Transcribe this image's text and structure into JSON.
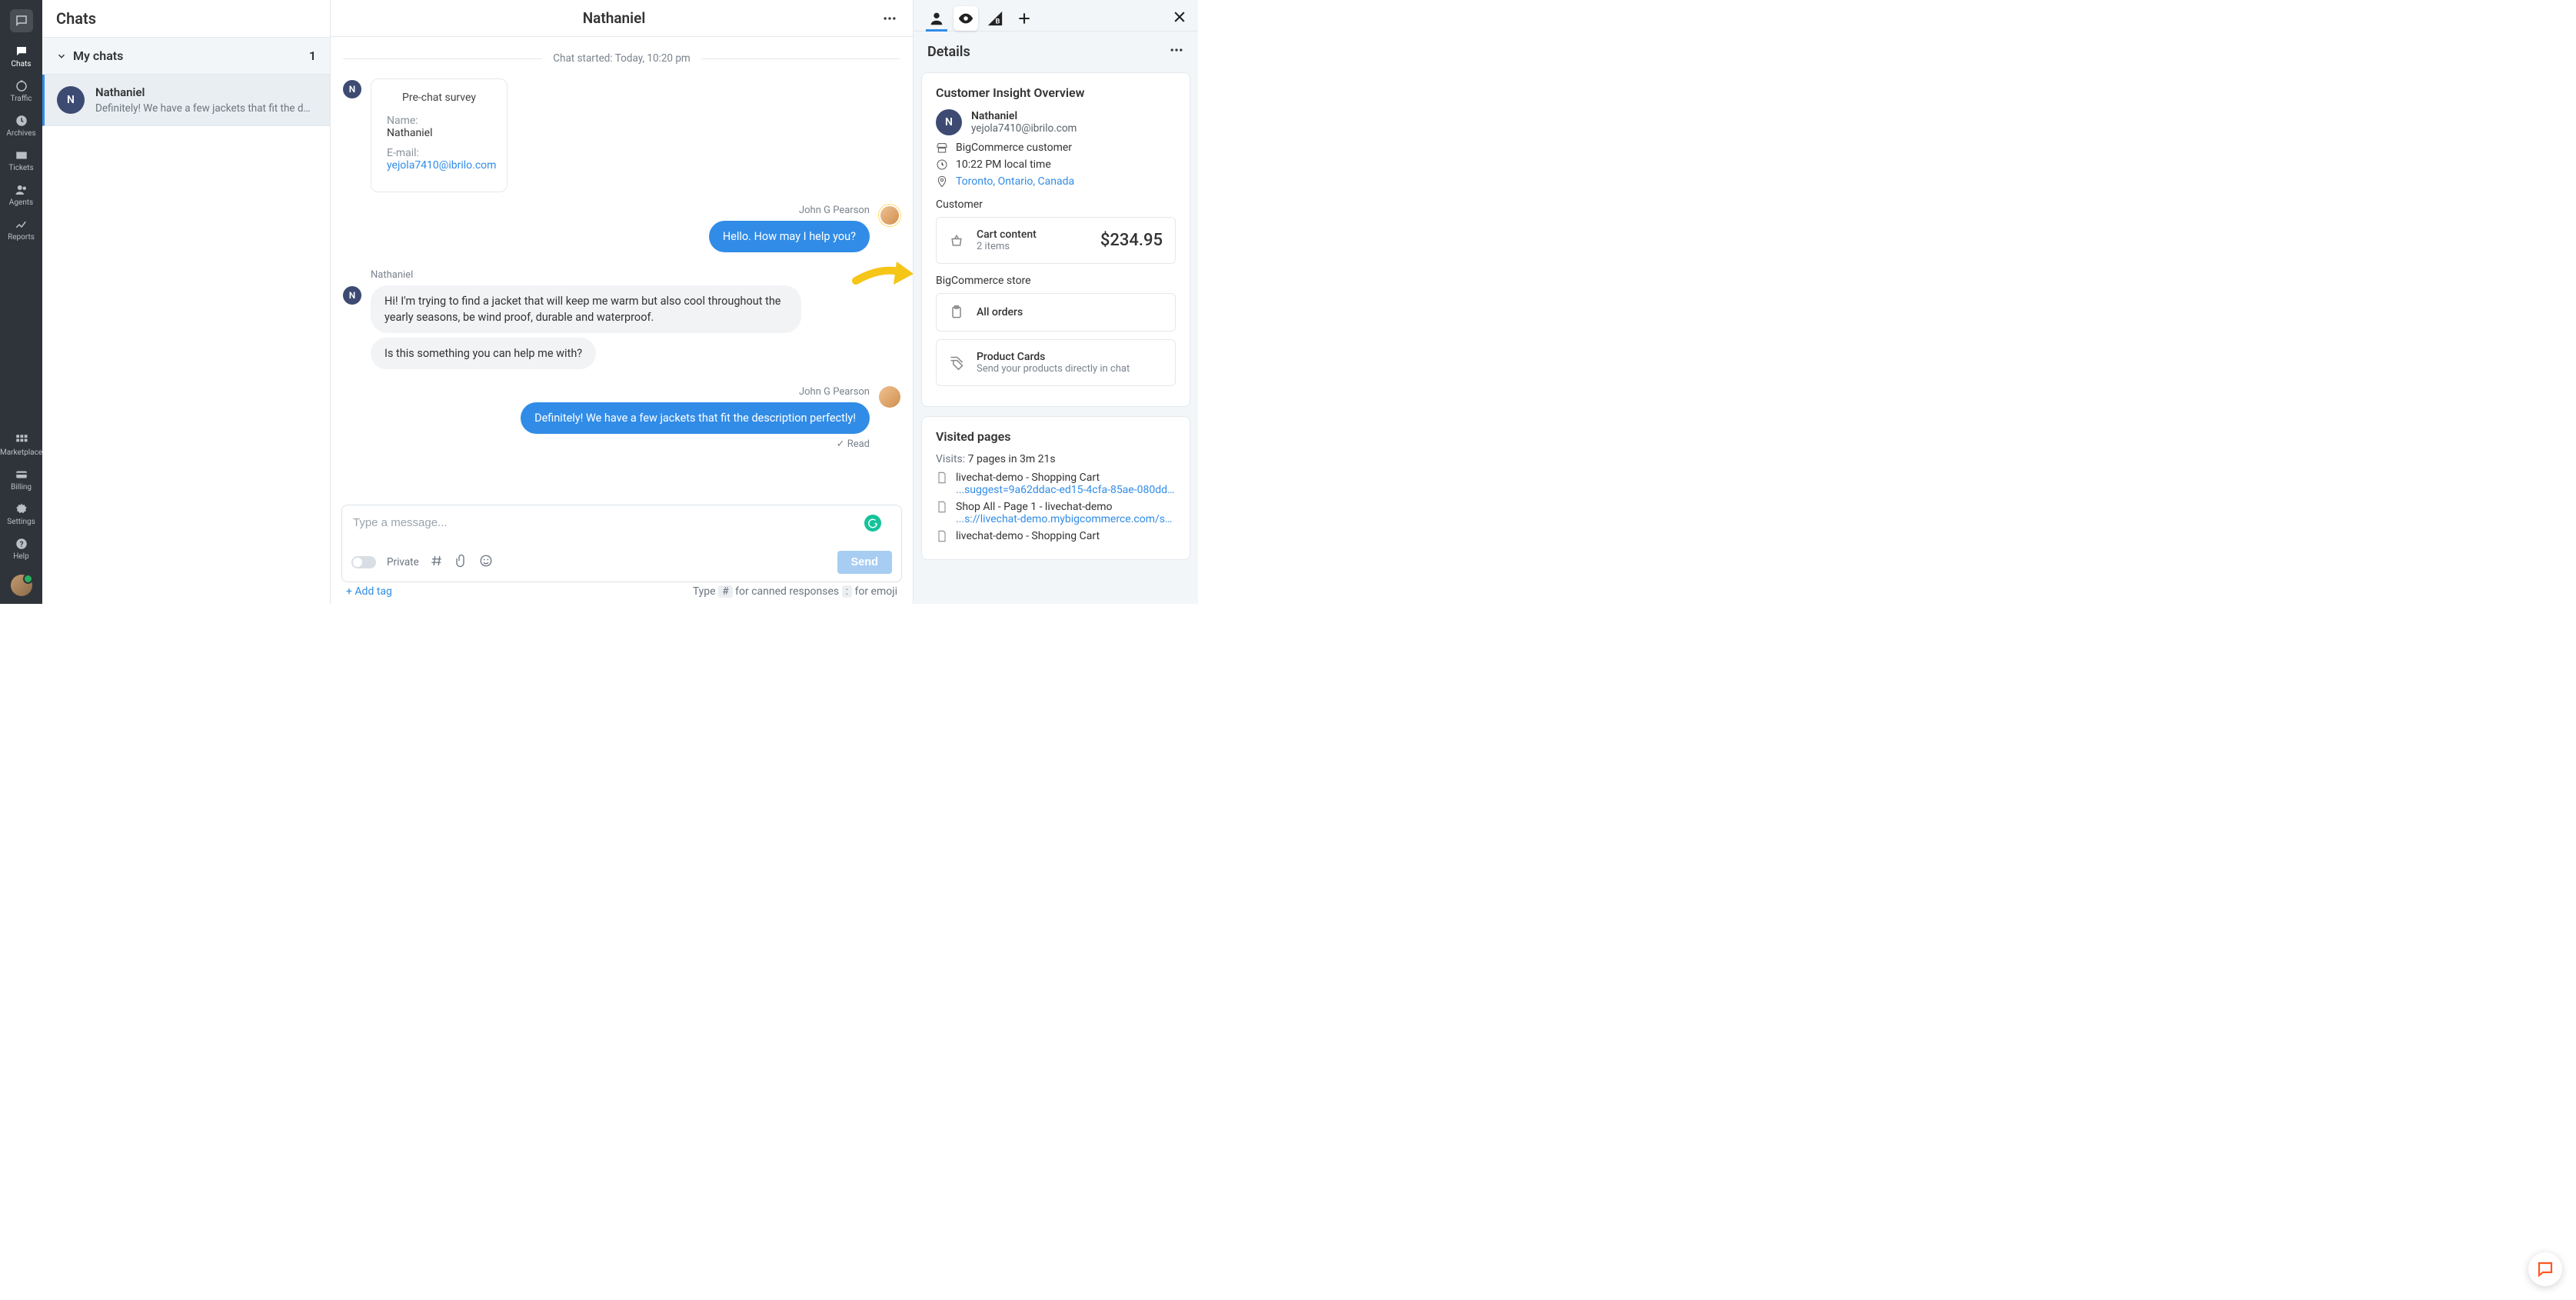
{
  "rail": {
    "items": [
      {
        "label": "Chats"
      },
      {
        "label": "Traffic"
      },
      {
        "label": "Archives"
      },
      {
        "label": "Tickets"
      },
      {
        "label": "Agents"
      },
      {
        "label": "Reports"
      }
    ],
    "bottom": [
      {
        "label": "Marketplace"
      },
      {
        "label": "Billing"
      },
      {
        "label": "Settings"
      },
      {
        "label": "Help"
      }
    ]
  },
  "list": {
    "header": "Chats",
    "group_label": "My chats",
    "group_count": "1",
    "item": {
      "initial": "N",
      "name": "Nathaniel",
      "preview": "Definitely! We have a few jackets that fit the desc…"
    }
  },
  "chat": {
    "title": "Nathaniel",
    "started": "Chat started: Today, 10:20 pm",
    "survey": {
      "heading": "Pre-chat survey",
      "name_label": "Name:",
      "name_value": "Nathaniel",
      "email_label": "E-mail:",
      "email_value": "yejola7410@ibrilo.com"
    },
    "avatar_initial": "N",
    "agent_name": "John G Pearson",
    "customer_name": "Nathaniel",
    "agent_msg1": "Hello. How may I help you?",
    "cust_msg1": "Hi! I'm trying to find a jacket that will keep me warm but also cool throughout the yearly seasons, be wind proof, durable and waterproof.",
    "cust_msg2": "Is this something you can help me with?",
    "agent_msg2": "Definitely! We have a few jackets that fit the description perfectly!",
    "read": "Read",
    "composer": {
      "placeholder": "Type a message...",
      "private": "Private",
      "send": "Send",
      "add_tag": "+ Add tag",
      "hint_pre": "Type ",
      "hint_key1": "#",
      "hint_mid1": " for canned responses ",
      "hint_key2": ":",
      "hint_mid2": " for emoji"
    }
  },
  "details": {
    "header": "Details",
    "card1_heading": "Customer Insight Overview",
    "customer": {
      "initial": "N",
      "name": "Nathaniel",
      "email": "yejola7410@ibrilo.com",
      "platform": "BigCommerce customer",
      "time": "10:22 PM local time",
      "location": "Toronto, Ontario, Canada"
    },
    "customer_section": "Customer",
    "cart": {
      "title": "Cart content",
      "sub": "2 items",
      "amount": "$234.95"
    },
    "store_section": "BigCommerce store",
    "all_orders": "All orders",
    "product_cards": {
      "title": "Product Cards",
      "sub": "Send your products directly in chat"
    },
    "visited": {
      "heading": "Visited pages",
      "visits_label": "Visits:",
      "visits_value": " 7 pages in 3m 21s",
      "pages": [
        {
          "title": "livechat-demo - Shopping Cart",
          "url": "...suggest=9a62ddac-ed15-4cfa-85ae-080ddd78355f"
        },
        {
          "title": "Shop All - Page 1 - livechat-demo",
          "url": "...s://livechat-demo.mybigcommerce.com/shop"
        },
        {
          "title": "livechat-demo - Shopping Cart",
          "url": ""
        }
      ]
    }
  }
}
